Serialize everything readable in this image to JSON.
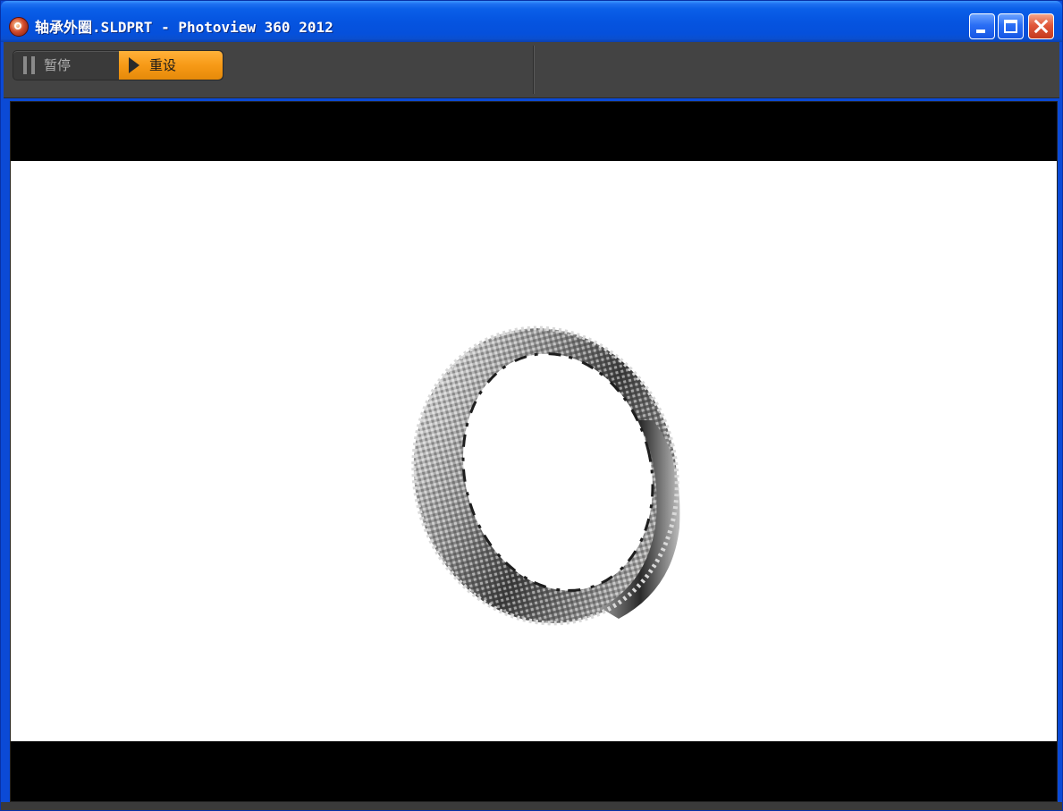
{
  "window": {
    "title": "轴承外圈.SLDPRT - Photoview 360 2012",
    "icon": "photoview-app-icon",
    "controls": {
      "minimize": "minimize-icon",
      "maximize": "maximize-icon",
      "close": "close-icon"
    }
  },
  "toolbar": {
    "pause_label": "暂停",
    "reset_label": "重设",
    "pause_icon": "pause-icon",
    "reset_icon": "play-icon",
    "accent_color": "#f79a16"
  },
  "viewport": {
    "background": "#ffffff",
    "letterbox_color": "#000000",
    "subject": "bearing-outer-ring-render"
  }
}
